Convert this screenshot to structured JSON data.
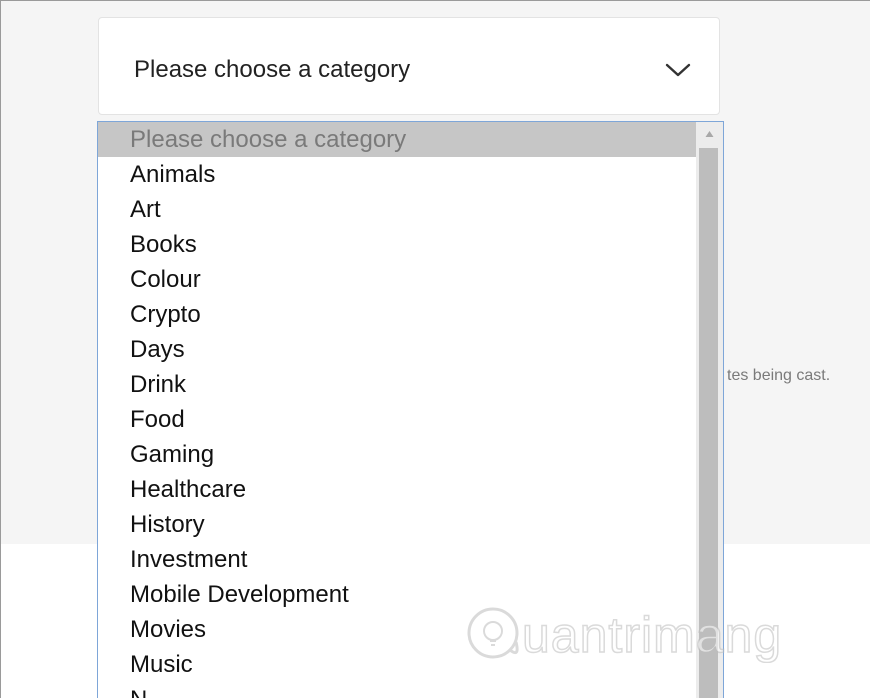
{
  "background": {
    "partial_help_text": "tes being cast."
  },
  "select": {
    "value": "Please choose a category",
    "chevron_icon": "chevron-down-icon"
  },
  "dropdown": {
    "selected_index": 0,
    "options": [
      "Please choose a category",
      "Animals",
      "Art",
      "Books",
      "Colour",
      "Crypto",
      "Days",
      "Drink",
      "Food",
      "Gaming",
      "Healthcare",
      "History",
      "Investment",
      "Mobile Development",
      "Movies",
      "Music",
      "N..."
    ]
  },
  "watermark": {
    "text": "uantrimang",
    "icon": "quantrimang-logo-icon"
  },
  "colors": {
    "page_bg": "#f5f5f5",
    "dropdown_border": "#7ea6d8",
    "selected_option_bg": "#c6c6c6",
    "scroll_thumb": "#bdbdbd"
  }
}
